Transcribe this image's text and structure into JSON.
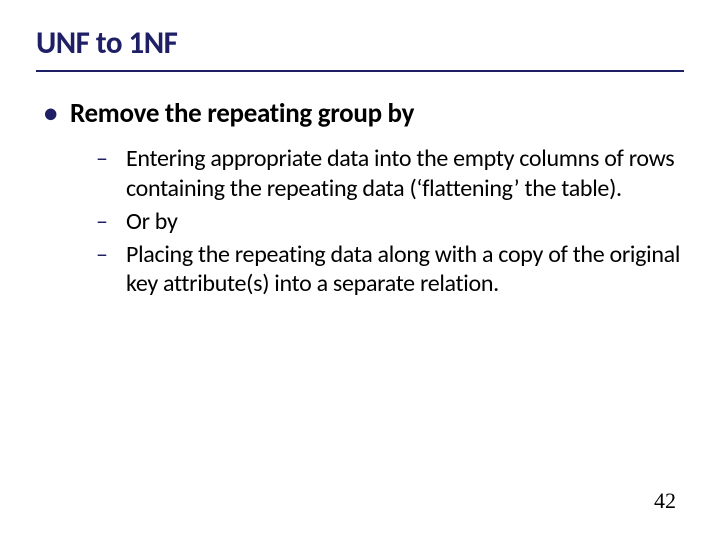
{
  "title": "UNF to 1NF",
  "bullets": {
    "level1": [
      {
        "text": "Remove the repeating group by"
      }
    ],
    "level2": [
      {
        "text": "Entering appropriate data into the empty columns of rows containing the repeating data (‘flattening’ the table)."
      },
      {
        "text": "Or by"
      },
      {
        "text": "Placing the repeating data along with a copy of the original key attribute(s) into a separate relation."
      }
    ]
  },
  "page_number": "42"
}
